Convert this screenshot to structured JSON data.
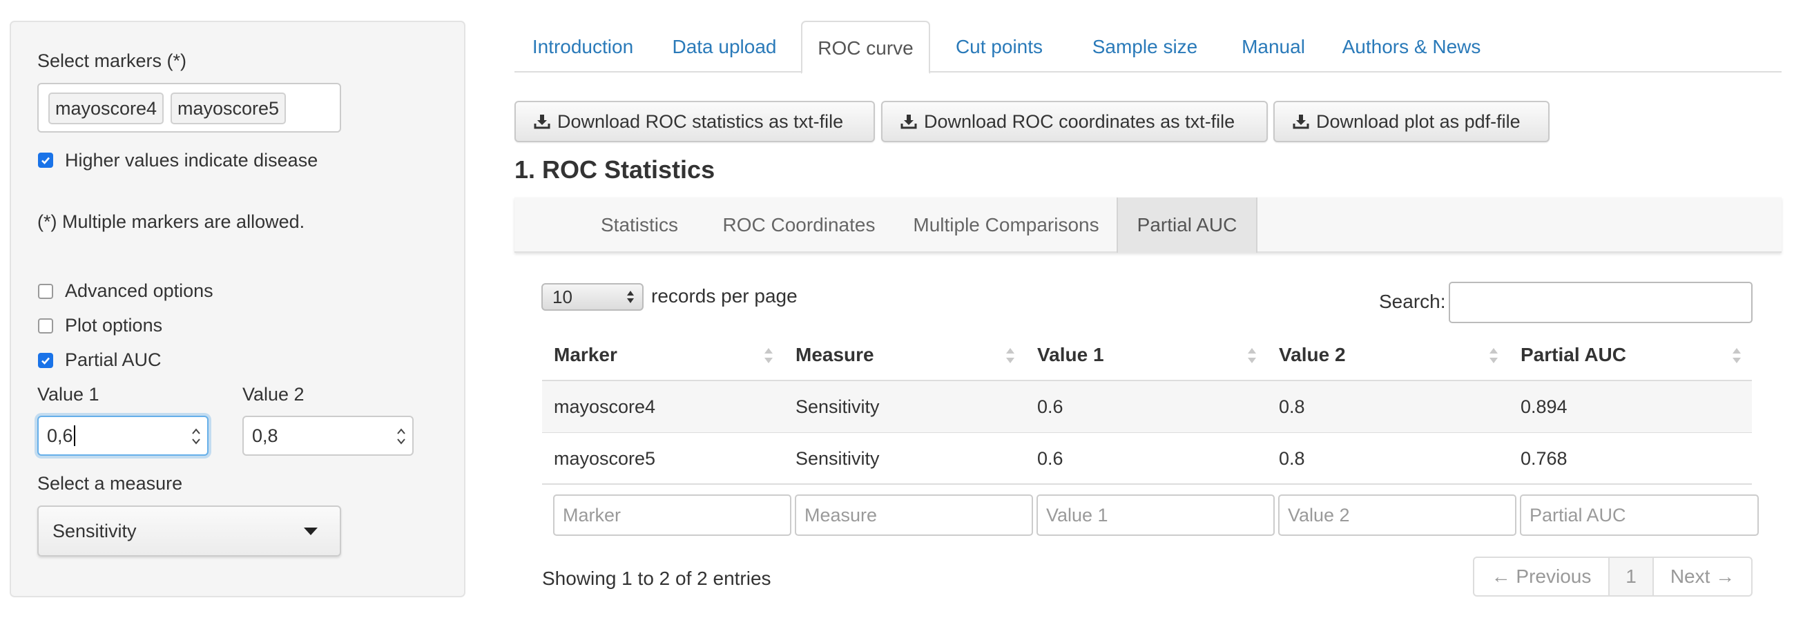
{
  "sidebar": {
    "markers_label": "Select markers (*)",
    "chips": [
      "mayoscore4",
      "mayoscore5"
    ],
    "higher_values_label": "Higher values indicate disease",
    "higher_values_checked": true,
    "multiple_note": "(*) Multiple markers are allowed.",
    "advanced_label": "Advanced options",
    "advanced_checked": false,
    "plot_label": "Plot options",
    "plot_checked": false,
    "partial_label": "Partial AUC",
    "partial_checked": true,
    "value1_label": "Value 1",
    "value1": "0,6",
    "value2_label": "Value 2",
    "value2": "0,8",
    "measure_label": "Select a measure",
    "measure_selected": "Sensitivity"
  },
  "nav": {
    "tabs": [
      "Introduction",
      "Data upload",
      "ROC curve",
      "Cut points",
      "Sample size",
      "Manual",
      "Authors & News"
    ],
    "active": "ROC curve"
  },
  "downloads": {
    "stats": "Download ROC statistics as txt-file",
    "coords": "Download ROC coordinates as txt-file",
    "plot": "Download plot as pdf-file"
  },
  "section_title": "1. ROC Statistics",
  "subtabs": {
    "items": [
      "Statistics",
      "ROC Coordinates",
      "Multiple Comparisons",
      "Partial AUC"
    ],
    "active": "Partial AUC"
  },
  "table": {
    "length_value": "10",
    "length_suffix": "records per page",
    "search_label": "Search:",
    "columns": [
      "Marker",
      "Measure",
      "Value 1",
      "Value 2",
      "Partial AUC"
    ],
    "rows": [
      [
        "mayoscore4",
        "Sensitivity",
        "0.6",
        "0.8",
        "0.894"
      ],
      [
        "mayoscore5",
        "Sensitivity",
        "0.6",
        "0.8",
        "0.768"
      ]
    ],
    "filter_placeholders": [
      "Marker",
      "Measure",
      "Value 1",
      "Value 2",
      "Partial AUC"
    ],
    "info": "Showing 1 to 2 of 2 entries",
    "pager": {
      "previous": "← Previous",
      "current": "1",
      "next": "Next →"
    }
  },
  "colors": {
    "link": "#2a7ab9",
    "check": "#1a73e8",
    "focus": "#66afe9"
  },
  "icons": [
    "checkmark-icon",
    "download-icon",
    "sort-icon",
    "spinner-arrows-icon",
    "caret-down-icon"
  ]
}
